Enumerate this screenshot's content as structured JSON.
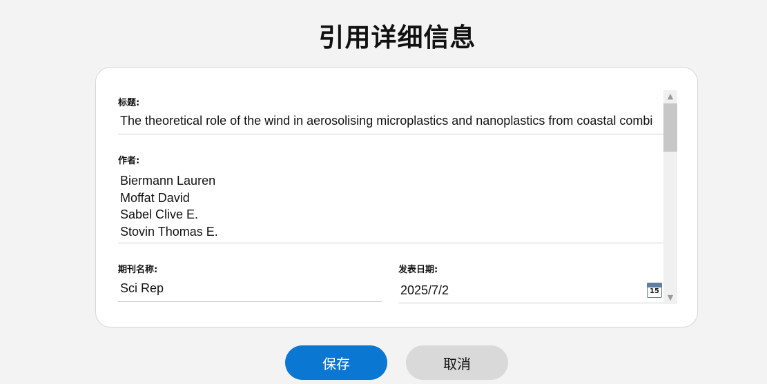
{
  "page": {
    "title": "引用详细信息"
  },
  "form": {
    "title_label": "标题:",
    "title_value": "The theoretical role of the wind in aerosolising microplastics and nanoplastics from coastal combi",
    "authors_label": "作者:",
    "authors": [
      "Biermann Lauren",
      "Moffat David",
      "Sabel Clive E.",
      "Stovin Thomas E."
    ],
    "journal_label": "期刊名称:",
    "journal_value": "Sci Rep",
    "date_label": "发表日期:",
    "date_value": "2025/7/2",
    "calendar_day": "15"
  },
  "buttons": {
    "save": "保存",
    "cancel": "取消"
  },
  "colors": {
    "accent": "#0a78d2",
    "cancel": "#d9d9d9",
    "background": "#f3f3f3"
  },
  "icons": {
    "calendar": "calendar-icon",
    "scroll_up": "chevron-up-icon",
    "scroll_down": "chevron-down-icon"
  }
}
